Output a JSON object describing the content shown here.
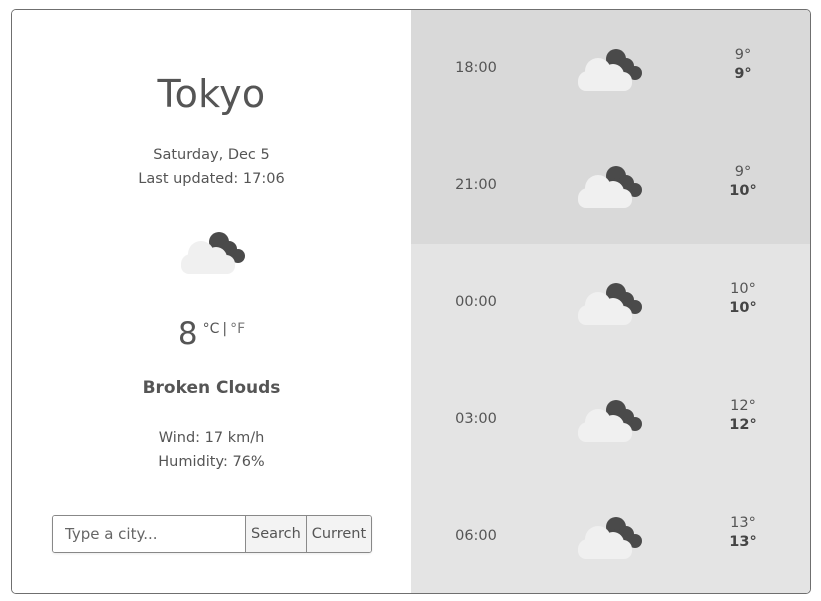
{
  "current": {
    "city": "Tokyo",
    "date": "Saturday, Dec 5",
    "last_updated": "Last updated: 17:06",
    "icon": "broken-clouds-icon",
    "temperature": "8",
    "unit_celsius": "°C",
    "unit_separator": "|",
    "unit_fahrenheit": "°F",
    "description": "Broken Clouds",
    "wind": "Wind: 17 km/h",
    "humidity": "Humidity: 76%"
  },
  "search": {
    "placeholder": "Type a city...",
    "value": "",
    "search_label": "Search",
    "current_label": "Current"
  },
  "forecast": [
    {
      "time": "18:00",
      "icon": "broken-clouds-icon",
      "temp_min": "9°",
      "temp_max": "9°"
    },
    {
      "time": "21:00",
      "icon": "broken-clouds-icon",
      "temp_min": "9°",
      "temp_max": "10°"
    },
    {
      "time": "00:00",
      "icon": "broken-clouds-icon",
      "temp_min": "10°",
      "temp_max": "10°"
    },
    {
      "time": "03:00",
      "icon": "broken-clouds-icon",
      "temp_min": "12°",
      "temp_max": "12°"
    },
    {
      "time": "06:00",
      "icon": "broken-clouds-icon",
      "temp_min": "13°",
      "temp_max": "13°"
    }
  ],
  "colors": {
    "text": "#555555",
    "forecast_today_bg": "#d9d9d9",
    "forecast_next_day_bg": "#e4e4e4",
    "cloud_dark": "#4a4a4a",
    "cloud_light": "#f0f0f0",
    "border": "#6f6f6f"
  }
}
